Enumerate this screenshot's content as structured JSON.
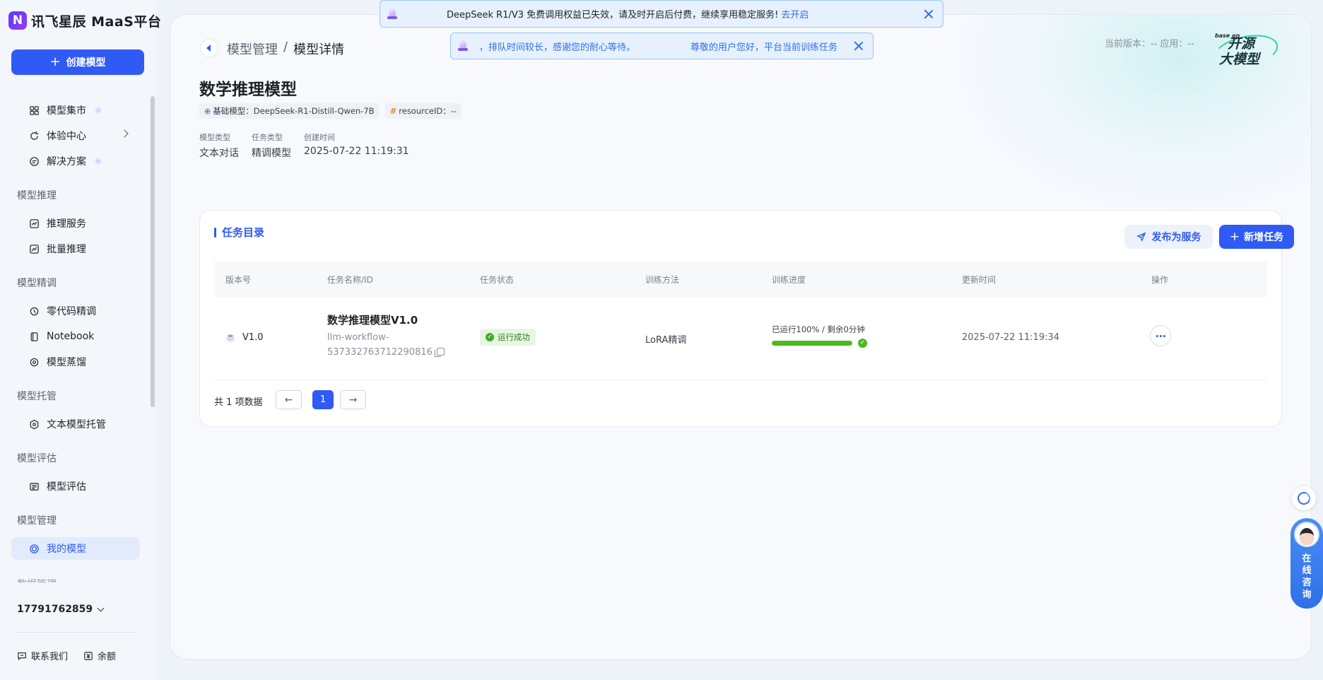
{
  "brand": {
    "logo_mark": "N",
    "name": "讯飞星辰 MaaS平台"
  },
  "sidebar": {
    "create_label": "创建模型",
    "top_items": [
      {
        "label": "模型集市",
        "icon": "grid-icon",
        "badge": true
      },
      {
        "label": "体验中心",
        "icon": "refresh-icon",
        "chevron": true
      },
      {
        "label": "解决方案",
        "icon": "solution-icon",
        "badge": true
      }
    ],
    "groups": [
      {
        "title": "模型推理",
        "items": [
          {
            "label": "推理服务",
            "icon": "chart-icon"
          },
          {
            "label": "批量推理",
            "icon": "batch-chart-icon"
          }
        ]
      },
      {
        "title": "模型精调",
        "items": [
          {
            "label": "零代码精调",
            "icon": "zero-code-icon"
          },
          {
            "label": "Notebook",
            "icon": "notebook-icon"
          },
          {
            "label": "模型蒸馏",
            "icon": "distill-icon"
          }
        ]
      },
      {
        "title": "模型托管",
        "items": [
          {
            "label": "文本模型托管",
            "icon": "hosting-icon"
          }
        ]
      },
      {
        "title": "模型评估",
        "items": [
          {
            "label": "模型评估",
            "icon": "evaluation-icon"
          }
        ]
      },
      {
        "title": "模型管理",
        "items": [
          {
            "label": "我的模型",
            "icon": "model-icon",
            "active": true
          }
        ]
      }
    ],
    "clipped_group": "数据管理",
    "account": "17791762859",
    "footer": [
      {
        "label": "联系我们",
        "icon": "chat-icon"
      },
      {
        "label": "余额",
        "icon": "yuan-icon"
      }
    ]
  },
  "notices": {
    "top": {
      "text": "DeepSeek R1/V3 免费调用权益已失效，请及时开启后付费，继续享用稳定服务!",
      "link": "去开启"
    },
    "queue": {
      "text_a": "，排队时间较长，感谢您的耐心等待。",
      "text_b": "尊敬的用户您好，平台当前训练任务"
    }
  },
  "header": {
    "breadcrumb": [
      "模型管理",
      "/",
      "模型详情"
    ],
    "title": "数学推理模型",
    "tags": [
      {
        "icon": "model-icon",
        "text": "基础模型：DeepSeek-R1-Distill-Qwen-7B"
      },
      {
        "icon": "hash-icon",
        "text": "resourceID：--"
      }
    ],
    "meta": [
      {
        "label": "模型类型",
        "value": "文本对话"
      },
      {
        "label": "任务类型",
        "value": "精调模型"
      },
      {
        "label": "创建时间",
        "value": "2025-07-22 11:19:31"
      }
    ],
    "version_info": "当前版本：--   应用：--",
    "badge": {
      "base": "base on",
      "line1": "开源",
      "line2": "大模型"
    }
  },
  "panel": {
    "title": "任务目录",
    "publish_label": "发布为服务",
    "add_label": "新增任务",
    "columns": [
      "版本号",
      "任务名称/ID",
      "任务状态",
      "训练方法",
      "训练进度",
      "更新时间",
      "操作"
    ],
    "rows": [
      {
        "version": "V1.0",
        "name": "数学推理模型V1.0",
        "id_line1": "llm-workflow-",
        "id_line2": "537332763712290816",
        "status": "运行成功",
        "method": "LoRA精调",
        "progress_text": "已运行100% / 剩余0分钟",
        "progress": 1.0,
        "updated": "2025-07-22 11:19:34"
      }
    ],
    "total_text": "共 1 项数据",
    "page": "1",
    "prev": "←",
    "next": "→"
  },
  "consult": {
    "text": "在线咨询"
  },
  "colors": {
    "primary": "#2f5bf4",
    "success": "#4cb81f",
    "notice_bg": "#e6f1fd"
  }
}
